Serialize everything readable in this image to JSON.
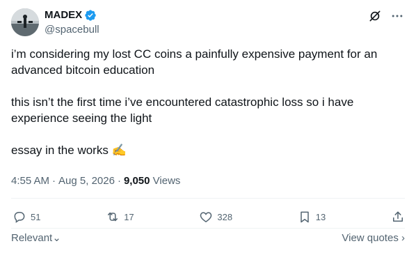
{
  "author": {
    "display_name": "MADEX",
    "handle": "@spacebull"
  },
  "tweet": {
    "paragraphs": [
      "i’m considering my lost CC coins a painfully expensive payment for an advanced bitcoin education",
      "this isn’t the first time i’ve encountered catastrophic loss so i have experience seeing the light",
      "essay in the works ✍️"
    ]
  },
  "meta": {
    "time": "4:55 AM",
    "sep": "·",
    "date": "Aug 5, 2026",
    "views_count": "9,050",
    "views_label": "Views"
  },
  "actions": {
    "replies": "51",
    "reposts": "17",
    "likes": "328",
    "bookmarks": "13"
  },
  "footer": {
    "sort_label": "Relevant",
    "quotes_label": "View quotes"
  },
  "colors": {
    "accent": "#1d9bf0",
    "muted": "#536471",
    "text": "#0f1419"
  }
}
